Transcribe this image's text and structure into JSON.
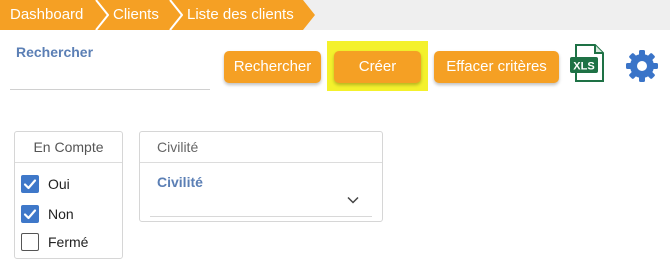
{
  "breadcrumb": {
    "items": [
      "Dashboard",
      "Clients",
      "Liste des clients"
    ]
  },
  "search": {
    "label": "Rechercher",
    "value": "",
    "placeholder": ""
  },
  "toolbar": {
    "search_label": "Rechercher",
    "create_label": "Créer",
    "clear_label": "Effacer critères",
    "export_icon_text": "XLS"
  },
  "filters": {
    "account": {
      "title": "En Compte",
      "options": [
        {
          "label": "Oui",
          "checked": true
        },
        {
          "label": "Non",
          "checked": true
        },
        {
          "label": "Fermé",
          "checked": false
        }
      ]
    },
    "civility": {
      "title": "Civilité",
      "field_label": "Civilité",
      "value": ""
    }
  },
  "colors": {
    "accent": "#f5a024",
    "highlight": "#f4f12c",
    "label_blue": "#5b7fb5",
    "checkbox": "#3f78c9",
    "excel_green": "#1e7145",
    "gear_blue": "#3a74c8"
  },
  "icons": {
    "export": "excel-xls-icon",
    "settings": "gear-icon",
    "dropdown": "chevron-down-icon"
  }
}
